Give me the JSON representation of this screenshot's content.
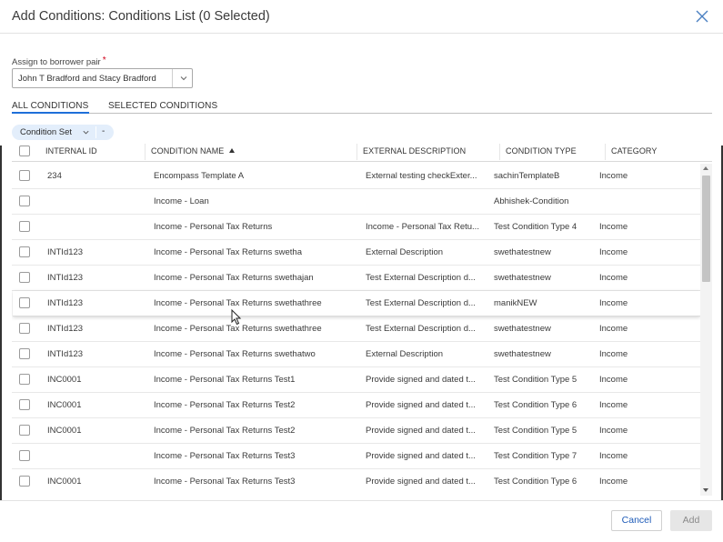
{
  "dialog": {
    "title": "Add Conditions: Conditions List (0 Selected)"
  },
  "borrower_pair": {
    "label": "Assign to borrower pair",
    "required_mark": "*",
    "value": "John T Bradford and Stacy Bradford"
  },
  "tabs": [
    {
      "label": "ALL CONDITIONS",
      "active": true
    },
    {
      "label": "SELECTED CONDITIONS",
      "active": false
    }
  ],
  "filter_chip": {
    "label": "Condition Set",
    "remove": "-"
  },
  "table": {
    "columns": [
      "INTERNAL ID",
      "CONDITION NAME",
      "EXTERNAL DESCRIPTION",
      "CONDITION TYPE",
      "CATEGORY"
    ],
    "rows": [
      {
        "id": "234",
        "name": "Encompass Template A",
        "desc": "External testing checkExter...",
        "type": "sachinTemplateB",
        "category": "Income"
      },
      {
        "id": "",
        "name": "Income - Loan",
        "desc": "",
        "type": "Abhishek-Condition",
        "category": ""
      },
      {
        "id": "",
        "name": "Income - Personal Tax Returns",
        "desc": "Income - Personal Tax Retu...",
        "type": "Test Condition Type 4",
        "category": "Income"
      },
      {
        "id": "INTId123",
        "name": "Income - Personal Tax Returns swetha",
        "desc": "External Description",
        "type": "swethatestnew",
        "category": "Income"
      },
      {
        "id": "INTId123",
        "name": "Income - Personal Tax Returns swethajan",
        "desc": "Test External Description d...",
        "type": "swethatestnew",
        "category": "Income"
      },
      {
        "id": "INTId123",
        "name": "Income - Personal Tax Returns swethathree",
        "desc": "Test External Description d...",
        "type": "manikNEW",
        "category": "Income"
      },
      {
        "id": "INTId123",
        "name": "Income - Personal Tax Returns swethathree",
        "desc": "Test External Description d...",
        "type": "swethatestnew",
        "category": "Income"
      },
      {
        "id": "INTId123",
        "name": "Income - Personal Tax Returns swethatwo",
        "desc": "External Description",
        "type": "swethatestnew",
        "category": "Income"
      },
      {
        "id": "INC0001",
        "name": "Income - Personal Tax Returns Test1",
        "desc": "Provide signed and dated t...",
        "type": "Test Condition Type 5",
        "category": "Income"
      },
      {
        "id": "INC0001",
        "name": "Income - Personal Tax Returns Test2",
        "desc": "Provide signed and dated t...",
        "type": "Test Condition Type 6",
        "category": "Income"
      },
      {
        "id": "INC0001",
        "name": "Income - Personal Tax Returns Test2",
        "desc": "Provide signed and dated t...",
        "type": "Test Condition Type 5",
        "category": "Income"
      },
      {
        "id": "",
        "name": "Income - Personal Tax Returns Test3",
        "desc": "Provide signed and dated t...",
        "type": "Test Condition Type 7",
        "category": "Income"
      },
      {
        "id": "INC0001",
        "name": "Income - Personal Tax Returns Test3",
        "desc": "Provide signed and dated t...",
        "type": "Test Condition Type 6",
        "category": "Income"
      }
    ]
  },
  "footer": {
    "cancel_label": "Cancel",
    "add_label": "Add"
  },
  "colors": {
    "accent": "#1e6fd9",
    "chip_bg": "#e3eefb",
    "disabled_bg": "#e6e6e6"
  }
}
